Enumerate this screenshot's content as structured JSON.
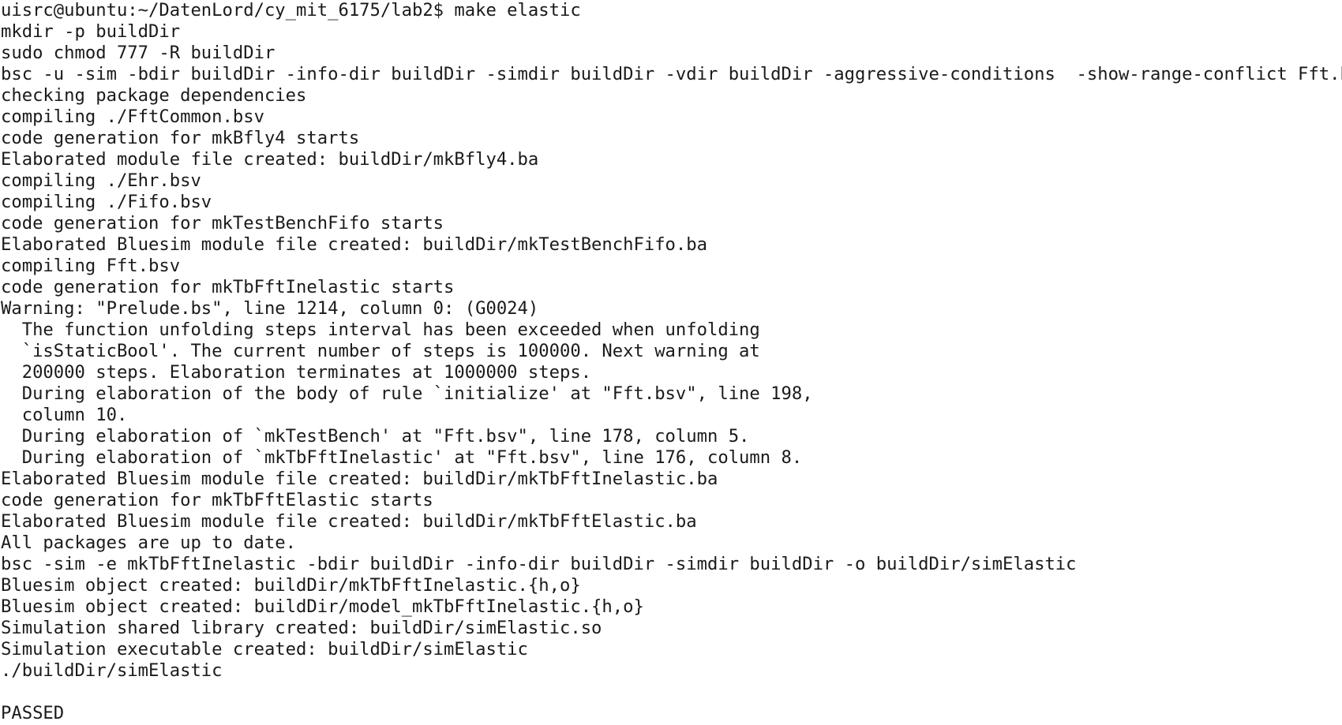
{
  "terminal": {
    "lines": [
      "uisrc@ubuntu:~/DatenLord/cy_mit_6175/lab2$ make elastic",
      "mkdir -p buildDir",
      "sudo chmod 777 -R buildDir",
      "bsc -u -sim -bdir buildDir -info-dir buildDir -simdir buildDir -vdir buildDir -aggressive-conditions  -show-range-conflict Fft.bsv",
      "checking package dependencies",
      "compiling ./FftCommon.bsv",
      "code generation for mkBfly4 starts",
      "Elaborated module file created: buildDir/mkBfly4.ba",
      "compiling ./Ehr.bsv",
      "compiling ./Fifo.bsv",
      "code generation for mkTestBenchFifo starts",
      "Elaborated Bluesim module file created: buildDir/mkTestBenchFifo.ba",
      "compiling Fft.bsv",
      "code generation for mkTbFftInelastic starts",
      "Warning: \"Prelude.bs\", line 1214, column 0: (G0024)",
      "  The function unfolding steps interval has been exceeded when unfolding",
      "  `isStaticBool'. The current number of steps is 100000. Next warning at",
      "  200000 steps. Elaboration terminates at 1000000 steps.",
      "  During elaboration of the body of rule `initialize' at \"Fft.bsv\", line 198,",
      "  column 10.",
      "  During elaboration of `mkTestBench' at \"Fft.bsv\", line 178, column 5.",
      "  During elaboration of `mkTbFftInelastic' at \"Fft.bsv\", line 176, column 8.",
      "Elaborated Bluesim module file created: buildDir/mkTbFftInelastic.ba",
      "code generation for mkTbFftElastic starts",
      "Elaborated Bluesim module file created: buildDir/mkTbFftElastic.ba",
      "All packages are up to date.",
      "bsc -sim -e mkTbFftInelastic -bdir buildDir -info-dir buildDir -simdir buildDir -o buildDir/simElastic",
      "Bluesim object created: buildDir/mkTbFftInelastic.{h,o}",
      "Bluesim object created: buildDir/model_mkTbFftInelastic.{h,o}",
      "Simulation shared library created: buildDir/simElastic.so",
      "Simulation executable created: buildDir/simElastic",
      "./buildDir/simElastic",
      "",
      "PASSED"
    ]
  }
}
